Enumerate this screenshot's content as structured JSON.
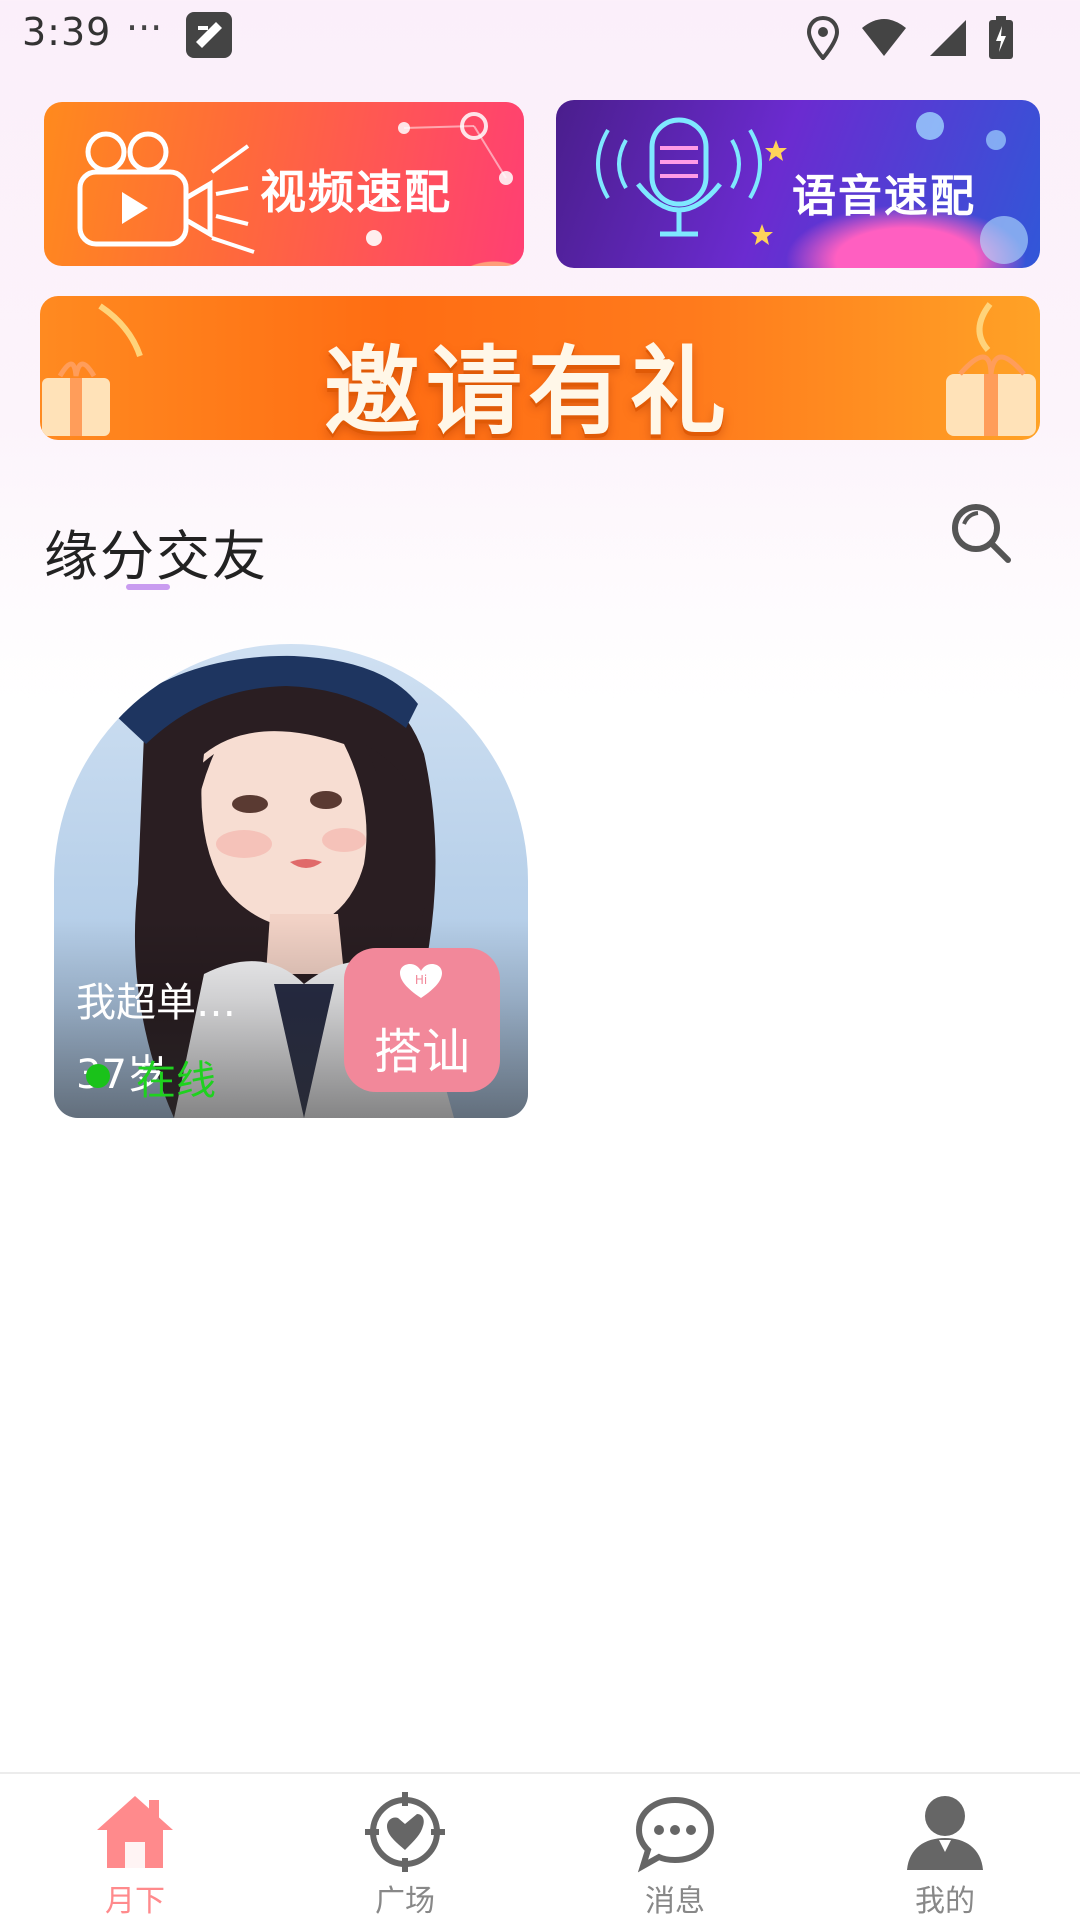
{
  "status_bar": {
    "time": "3:39",
    "dots": "···"
  },
  "promos": {
    "video_match": "视频速配",
    "voice_match": "语音速配",
    "invite": "邀请有礼"
  },
  "section": {
    "title": "缘分交友"
  },
  "profile": {
    "name": "我超单…",
    "age": "37岁",
    "status": "在线",
    "greet_label": "搭讪",
    "greet_badge": "Hi"
  },
  "nav": {
    "items": [
      {
        "label": "月下",
        "icon": "home-icon",
        "active": true
      },
      {
        "label": "广场",
        "icon": "compass-heart-icon",
        "active": false
      },
      {
        "label": "消息",
        "icon": "chat-bubble-icon",
        "active": false
      },
      {
        "label": "我的",
        "icon": "person-icon",
        "active": false
      }
    ]
  },
  "colors": {
    "accent": "#ff8a8c",
    "greet_button": "#f2889a",
    "online": "#1fd11f",
    "underline": "#c99cf0"
  }
}
